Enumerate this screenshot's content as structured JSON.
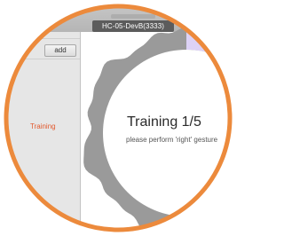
{
  "window": {
    "title": "HC-05-DevB(3333)"
  },
  "sidebar": {
    "add_label": "add",
    "items": [
      {
        "label": "Training",
        "selected": true
      }
    ]
  },
  "training": {
    "title": "Training 1/5",
    "subtitle": "please perform 'right' gesture",
    "progress_fraction": 0.08
  },
  "colors": {
    "accent_orange": "#ec8a3c",
    "training_label": "#e25a2f",
    "wave_gray": "#9a9a9a",
    "progress_lavender": "#ddd2f6"
  }
}
